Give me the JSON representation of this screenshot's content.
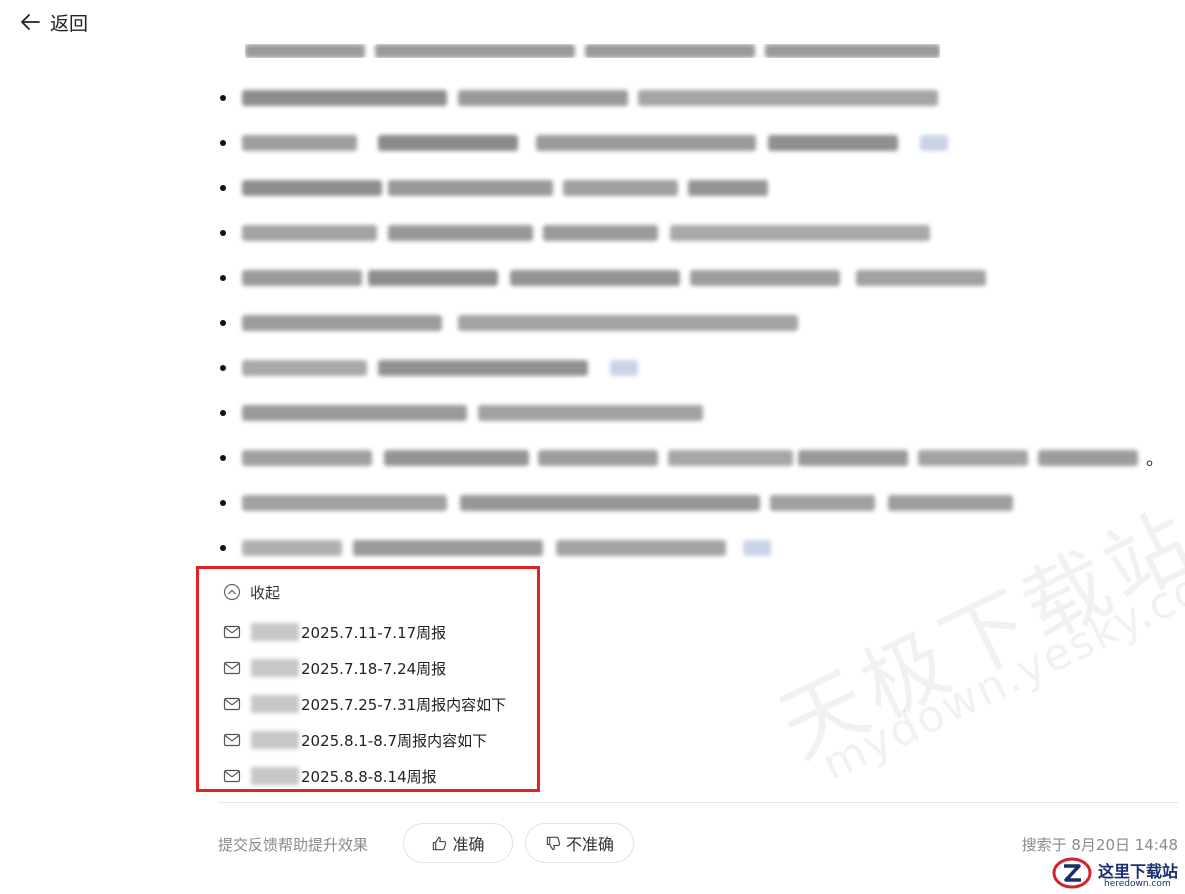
{
  "header": {
    "back_label": "返回"
  },
  "bullets": {
    "count": 11,
    "tail_mark": "。"
  },
  "references": {
    "collapse_label": "收起",
    "items": [
      {
        "title": "2025.7.11-7.17周报"
      },
      {
        "title": "2025.7.18-7.24周报"
      },
      {
        "title": "2025.7.25-7.31周报内容如下"
      },
      {
        "title": "2025.8.1-8.7周报内容如下"
      },
      {
        "title": "2025.8.8-8.14周报"
      }
    ]
  },
  "feedback": {
    "prompt": "提交反馈帮助提升效果",
    "accurate_label": "准确",
    "inaccurate_label": "不准确",
    "search_time": "搜索于 8月20日 14:48"
  },
  "watermark": {
    "text_cn": "天极下载站",
    "text_en": "mydown.yesky.com"
  },
  "logo": {
    "text_cn": "这里下载站",
    "text_en": "heredown.com"
  },
  "colors": {
    "highlight_border": "#e02424",
    "muted_text": "#8a8a8a",
    "logo_blue": "#1a2e6e",
    "logo_red": "#d2232a"
  }
}
